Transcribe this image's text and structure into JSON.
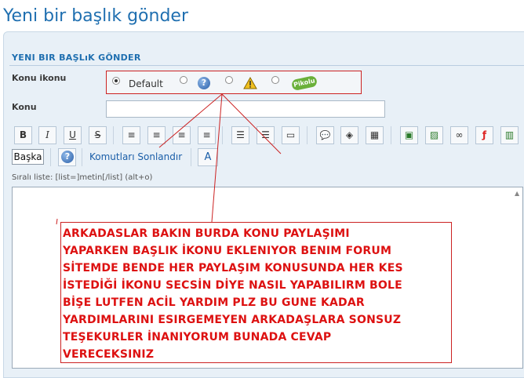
{
  "page": {
    "title": "Yeni bir başlık gönder",
    "section_header": "YENI BIR BAŞLıK GÖNDER"
  },
  "form": {
    "icon_label": "Konu ikonu",
    "icon_options": [
      {
        "label": "Default",
        "icon": "none",
        "selected": true
      },
      {
        "label": "",
        "icon": "question-icon",
        "selected": false
      },
      {
        "label": "",
        "icon": "warning-icon",
        "selected": false
      },
      {
        "label": "",
        "icon": "sticker-icon",
        "selected": false
      }
    ],
    "sticker_text": "Pikolu",
    "subject_label": "Konu",
    "subject_value": ""
  },
  "toolbar": {
    "buttons": [
      {
        "name": "bold-button",
        "glyph": "B"
      },
      {
        "name": "italic-button",
        "glyph": "I"
      },
      {
        "name": "underline-button",
        "glyph": "U"
      },
      {
        "name": "strike-button",
        "glyph": "S"
      },
      {
        "name": "align-left-button",
        "glyph": "≡"
      },
      {
        "name": "align-center-button",
        "glyph": "≡"
      },
      {
        "name": "align-right-button",
        "glyph": "≡"
      },
      {
        "name": "justify-button",
        "glyph": "≡"
      },
      {
        "name": "bullet-list-button",
        "glyph": "☰"
      },
      {
        "name": "numbered-list-button",
        "glyph": "☰"
      },
      {
        "name": "hr-button",
        "glyph": "▭"
      },
      {
        "name": "quote-button",
        "glyph": "💬"
      },
      {
        "name": "code-button",
        "glyph": "◈"
      },
      {
        "name": "table-button",
        "glyph": "▦"
      },
      {
        "name": "image-gallery-button",
        "glyph": "▣"
      },
      {
        "name": "image-button",
        "glyph": "▨"
      },
      {
        "name": "link-button",
        "glyph": "∞"
      },
      {
        "name": "flash-button",
        "glyph": "ƒ"
      },
      {
        "name": "video-button",
        "glyph": "▥"
      }
    ],
    "other_label": "Başka",
    "end_commands_label": "Komutları Sonlandır",
    "font_size_glyph": "A"
  },
  "editor": {
    "hint": "Sıralı liste: [list=]metin[/list] (alt+o)",
    "content_lines": [
      "ARKADASLAR BAKIN BURDA KONU PAYLAŞIMI",
      "YAPARKEN BAŞLIK İKONU EKLENIYOR BENIM FORUM",
      "SİTEMDE BENDE HER PAYLAŞIM KONUSUNDA HER KES",
      "İSTEDİĞİ İKONU SECSİN DİYE NASIL YAPABILIRM BOLE",
      "BİŞE LUTFEN ACİL YARDIM PLZ BU GUNE KADAR",
      "YARDIMLARINI ESIRGEMEYEN ARKADAŞLARA SONSUZ",
      "TEŞEKURLER İNANIYORUM BUNADA CEVAP",
      "VERECEKSINIZ"
    ]
  },
  "colors": {
    "accent": "#1f6fb0",
    "annotation": "#cc2222",
    "panel": "#e8f0f7"
  }
}
